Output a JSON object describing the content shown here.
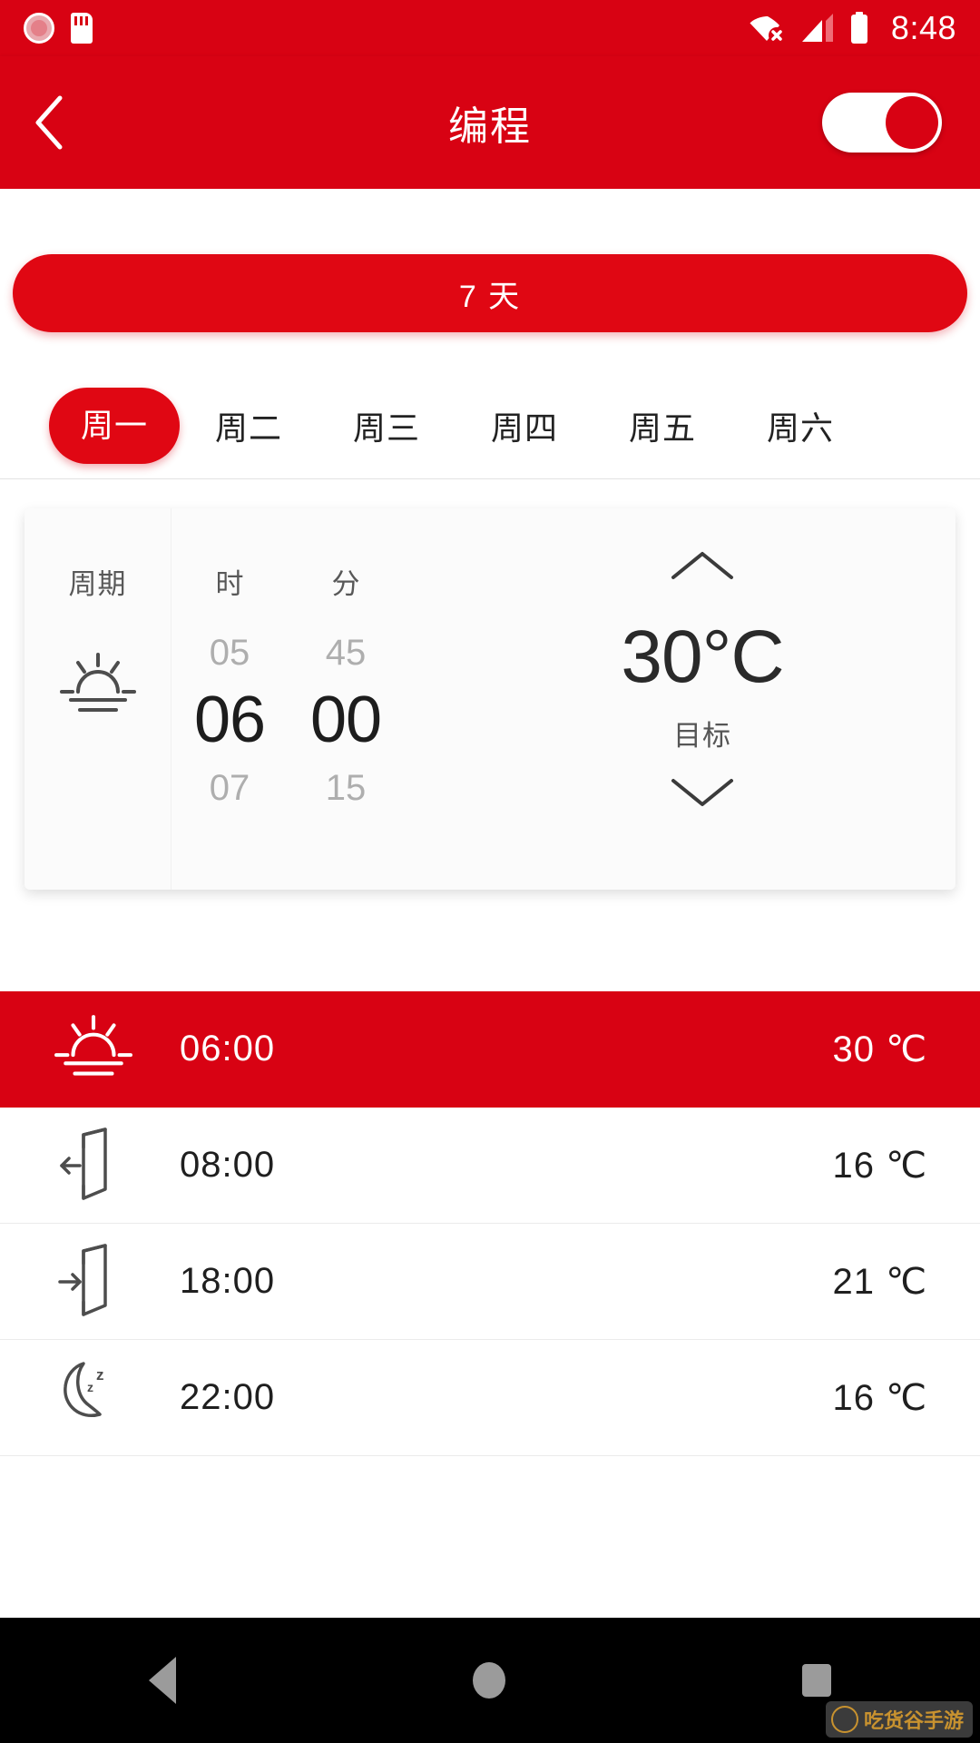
{
  "statusbar": {
    "time": "8:48",
    "icons": [
      "sun-status-icon",
      "sd-card-icon",
      "wifi-off-icon",
      "cellular-signal-icon",
      "battery-icon"
    ]
  },
  "appbar": {
    "title": "编程",
    "back_icon": "chevron-left-icon",
    "toggle_on": true,
    "toggle_name": "program-enable-toggle"
  },
  "mode_button": {
    "label": "7 天"
  },
  "day_tabs": [
    {
      "label": "周一",
      "active": true
    },
    {
      "label": "周二",
      "active": false
    },
    {
      "label": "周三",
      "active": false
    },
    {
      "label": "周四",
      "active": false
    },
    {
      "label": "周五",
      "active": false
    },
    {
      "label": "周六",
      "active": false
    }
  ],
  "picker": {
    "cycle_header": "周期",
    "cycle_icon": "sunrise-icon",
    "hour_header": "时",
    "hour_prev": "05",
    "hour_value": "06",
    "hour_next": "07",
    "minute_header": "分",
    "minute_prev": "45",
    "minute_value": "00",
    "minute_next": "15",
    "temp_up_icon": "chevron-up-icon",
    "temp_value": "30°C",
    "temp_label": "目标",
    "temp_down_icon": "chevron-down-icon"
  },
  "schedule": [
    {
      "icon": "sunrise-icon",
      "time": "06:00",
      "temp": "30 ℃",
      "active": true
    },
    {
      "icon": "door-leave-icon",
      "time": "08:00",
      "temp": "16 ℃",
      "active": false
    },
    {
      "icon": "door-return-icon",
      "time": "18:00",
      "temp": "21 ℃",
      "active": false
    },
    {
      "icon": "moon-sleep-icon",
      "time": "22:00",
      "temp": "16 ℃",
      "active": false
    }
  ],
  "navbar": {
    "back": "nav-back-icon",
    "home": "nav-home-icon",
    "recent": "nav-recent-icon"
  },
  "watermark": {
    "text": "吃货谷手游"
  },
  "colors": {
    "brand_red": "#d80213",
    "accent_red": "#e00713",
    "text_dark": "#1f1f1f",
    "text_muted": "#aeaeae"
  }
}
